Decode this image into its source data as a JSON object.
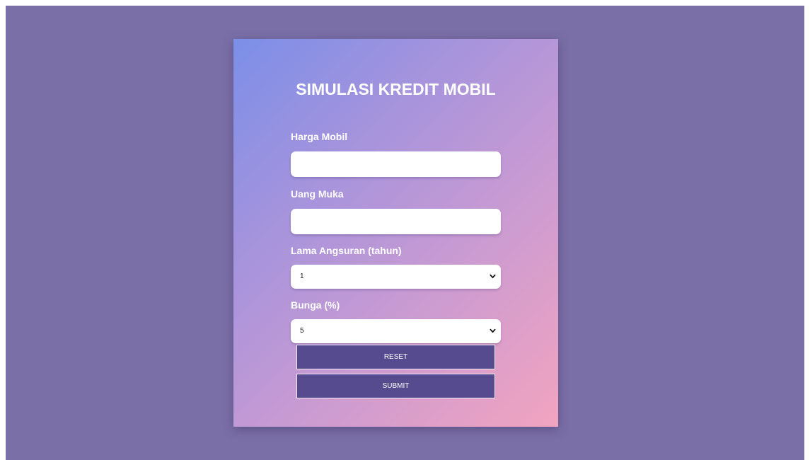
{
  "form": {
    "title": "SIMULASI KREDIT MOBIL",
    "harga_mobil": {
      "label": "Harga Mobil",
      "value": ""
    },
    "uang_muka": {
      "label": "Uang Muka",
      "value": ""
    },
    "lama_angsuran": {
      "label": "Lama Angsuran (tahun)",
      "selected": "1"
    },
    "bunga": {
      "label": "Bunga (%)",
      "selected": "5"
    },
    "reset_label": "RESET",
    "submit_label": "SUBMIT"
  },
  "colors": {
    "page_background": "#7a6fa6",
    "button": "#574b8f",
    "gradient_start": "#7b8fe8",
    "gradient_end": "#f2a4bf"
  },
  "icons": {
    "select_arrow": "chevron-down-icon"
  }
}
